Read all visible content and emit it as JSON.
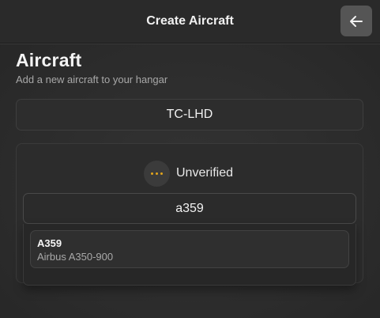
{
  "header": {
    "title": "Create Aircraft",
    "back_icon": "arrow-left-icon"
  },
  "page": {
    "title": "Aircraft",
    "subtitle": "Add a new aircraft to your hangar"
  },
  "registration": {
    "value": "TC-LHD"
  },
  "verification": {
    "status_icon": "ellipsis-icon",
    "status_color": "#e2a41c",
    "status_label": "Unverified"
  },
  "aircraft_type": {
    "value": "a359",
    "options": [
      {
        "code": "A359",
        "name": "Airbus A350-900"
      }
    ]
  }
}
